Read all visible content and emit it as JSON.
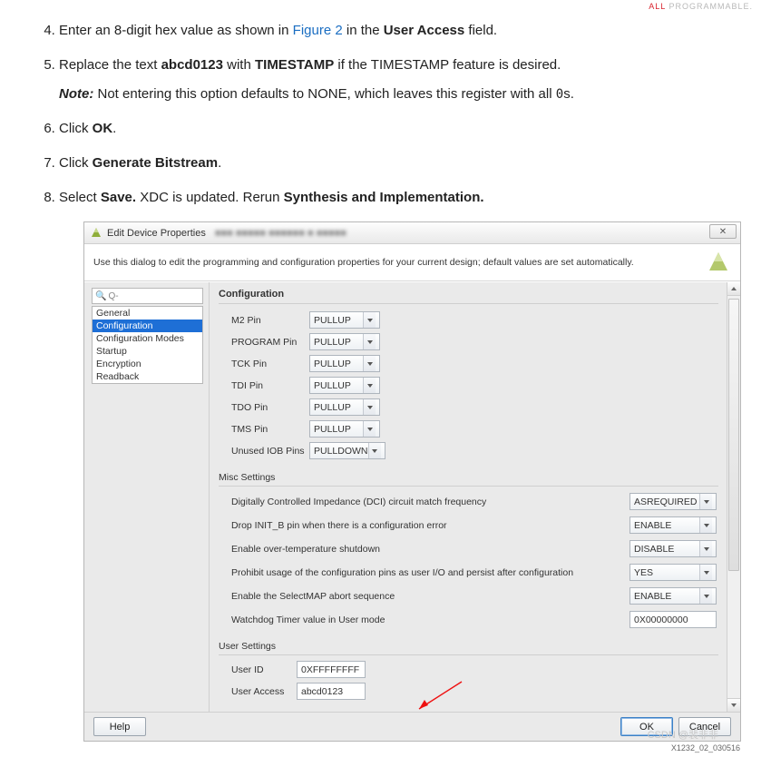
{
  "header_tag": {
    "red": "ALL",
    "grey": "PROGRAMMABLE."
  },
  "steps": {
    "start": 4,
    "s4": {
      "pre": "Enter an 8-digit hex value as shown in ",
      "link": "Figure 2",
      "mid": " in the ",
      "bold": "User Access",
      "post": " field."
    },
    "s5": {
      "pre": "Replace the text ",
      "b1": "abcd0123",
      "mid": " with ",
      "b2": "TIMESTAMP",
      "post": " if the TIMESTAMP feature is desired.",
      "note_label": "Note:",
      "note_text": " Not entering this option defaults to NONE, which leaves this register with all ",
      "code": "0",
      "note_tail": "s."
    },
    "s6": {
      "pre": "Click ",
      "bold": "OK",
      "post": "."
    },
    "s7": {
      "pre": "Click ",
      "bold": "Generate Bitstream",
      "post": "."
    },
    "s8": {
      "pre": "Select ",
      "b1": "Save.",
      "mid": " XDC is updated. Rerun ",
      "b2": "Synthesis and Implementation."
    }
  },
  "dialog": {
    "title": "Edit Device Properties",
    "close_glyph": "✕",
    "instruction": "Use this dialog to edit the programming and configuration properties for your current design; default values are set automatically.",
    "search_placeholder": "Q-",
    "categories": [
      "General",
      "Configuration",
      "Configuration Modes",
      "Startup",
      "Encryption",
      "Readback"
    ],
    "selected_index": 1,
    "panel_title": "Configuration",
    "pin_rows": [
      {
        "label": "M2 Pin",
        "value": "PULLUP"
      },
      {
        "label": "PROGRAM Pin",
        "value": "PULLUP"
      },
      {
        "label": "TCK Pin",
        "value": "PULLUP"
      },
      {
        "label": "TDI Pin",
        "value": "PULLUP"
      },
      {
        "label": "TDO Pin",
        "value": "PULLUP"
      },
      {
        "label": "TMS Pin",
        "value": "PULLUP"
      },
      {
        "label": "Unused IOB Pins",
        "value": "PULLDOWN"
      }
    ],
    "misc_header": "Misc Settings",
    "misc_rows": [
      {
        "desc": "Digitally Controlled Impedance (DCI) circuit match frequency",
        "value": "ASREQUIRED",
        "type": "select"
      },
      {
        "desc": "Drop INIT_B pin when there is a configuration error",
        "value": "ENABLE",
        "type": "select"
      },
      {
        "desc": "Enable over-temperature shutdown",
        "value": "DISABLE",
        "type": "select"
      },
      {
        "desc": "Prohibit usage of the configuration pins as user I/O and persist after configuration",
        "value": "YES",
        "type": "select"
      },
      {
        "desc": "Enable the SelectMAP abort sequence",
        "value": "ENABLE",
        "type": "select"
      },
      {
        "desc": "Watchdog Timer value in User mode",
        "value": "0X00000000",
        "type": "text"
      }
    ],
    "user_header": "User Settings",
    "user_rows": [
      {
        "label": "User ID",
        "value": "0XFFFFFFFF"
      },
      {
        "label": "User Access",
        "value": "abcd0123"
      }
    ],
    "buttons": {
      "help": "Help",
      "ok": "OK",
      "cancel": "Cancel"
    }
  },
  "figure_id": "X1232_02_030516",
  "watermark": "CSDN @裴非非"
}
